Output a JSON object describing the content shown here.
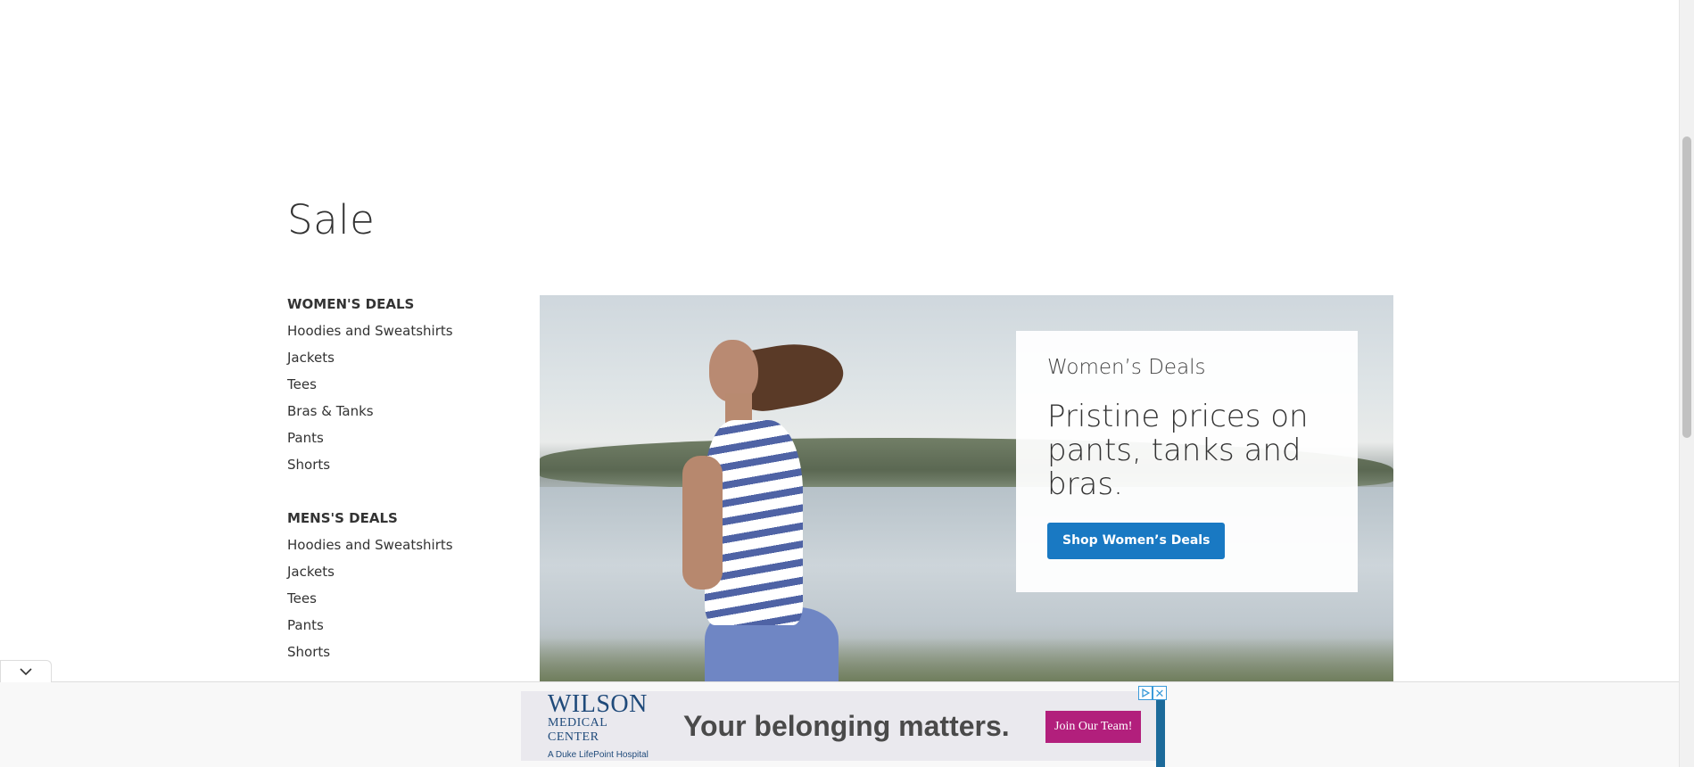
{
  "page": {
    "title": "Sale"
  },
  "sidebar": {
    "groups": [
      {
        "title": "WOMEN'S DEALS",
        "items": [
          "Hoodies and Sweatshirts",
          "Jackets",
          "Tees",
          "Bras & Tanks",
          "Pants",
          "Shorts"
        ]
      },
      {
        "title": "MENS'S DEALS",
        "items": [
          "Hoodies and Sweatshirts",
          "Jackets",
          "Tees",
          "Pants",
          "Shorts"
        ]
      }
    ]
  },
  "hero": {
    "eyebrow": "Women’s Deals",
    "headline": "Pristine prices on pants, tanks and bras.",
    "button_label": "Shop Women’s Deals"
  },
  "ad": {
    "logo_name": "WILSON",
    "logo_sub": "MEDICAL CENTER",
    "logo_tag": "A Duke LifePoint Hospital",
    "slogan": "Your belonging matters.",
    "cta_label": "Join Our Team!",
    "close_label": "✕",
    "colors": {
      "cta": "#b21f7c",
      "brand": "#1f4a7a"
    }
  },
  "icons": {
    "collapse": "chevron-down-icon",
    "adchoices": "play-triangle-icon",
    "close": "close-icon"
  },
  "colors": {
    "primary_button": "#1979c3"
  }
}
